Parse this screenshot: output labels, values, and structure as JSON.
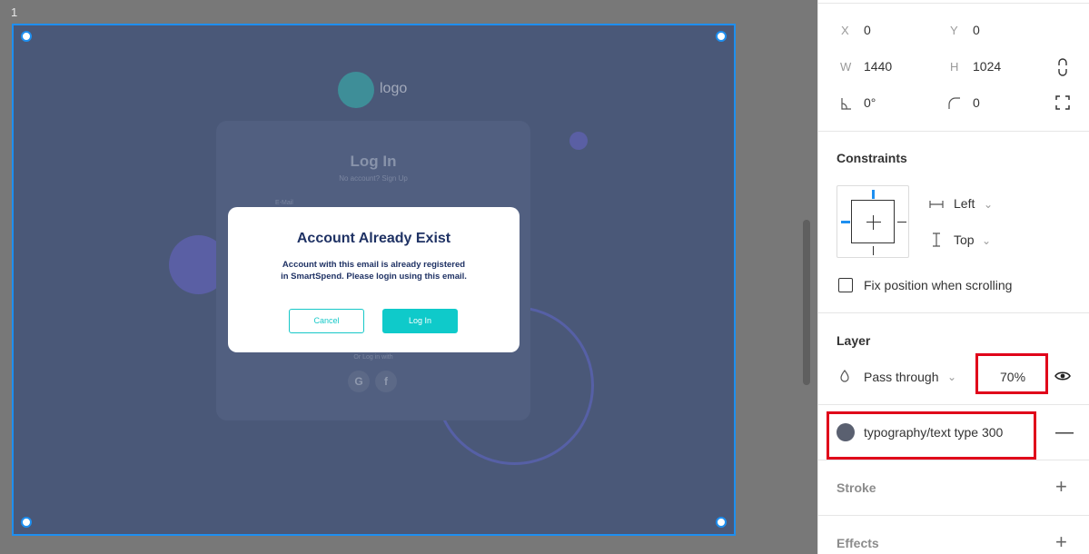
{
  "canvas": {
    "frame_label": "1",
    "preview": {
      "logo_text": "logo",
      "card_title": "Log In",
      "card_subtitle": "No account? Sign Up",
      "email_label": "E-Mail",
      "or_login_with": "Or Log in with",
      "social": [
        "G",
        "f"
      ]
    },
    "modal": {
      "title": "Account Already Exist",
      "body": "Account with this email is already registered in SmartSpend. Please login using this email.",
      "cancel_label": "Cancel",
      "login_label": "Log In"
    }
  },
  "panel": {
    "x_label": "X",
    "x_value": "0",
    "y_label": "Y",
    "y_value": "0",
    "w_label": "W",
    "w_value": "1440",
    "h_label": "H",
    "h_value": "1024",
    "rotation_value": "0°",
    "radius_value": "0",
    "constraints": {
      "title": "Constraints",
      "horizontal": "Left",
      "vertical": "Top",
      "fix_position_label": "Fix position when scrolling"
    },
    "layer": {
      "title": "Layer",
      "blend_mode": "Pass through",
      "opacity": "70%"
    },
    "fill": {
      "style_name": "typography/text type 300",
      "swatch_color": "#5a6070"
    },
    "stroke_title": "Stroke",
    "effects_title": "Effects"
  },
  "colors": {
    "selection": "#1e8ff0",
    "highlight": "#e0001a",
    "accent": "#0fcaca"
  }
}
